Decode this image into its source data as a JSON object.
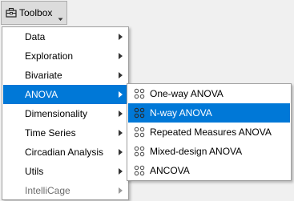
{
  "toolbar": {
    "toolbox_label": "Toolbox"
  },
  "main_menu": {
    "items": [
      {
        "label": "Data",
        "has_submenu": true,
        "highlighted": false,
        "disabled": false
      },
      {
        "label": "Exploration",
        "has_submenu": true,
        "highlighted": false,
        "disabled": false
      },
      {
        "label": "Bivariate",
        "has_submenu": true,
        "highlighted": false,
        "disabled": false
      },
      {
        "label": "ANOVA",
        "has_submenu": true,
        "highlighted": true,
        "disabled": false
      },
      {
        "label": "Dimensionality",
        "has_submenu": true,
        "highlighted": false,
        "disabled": false
      },
      {
        "label": "Time Series",
        "has_submenu": true,
        "highlighted": false,
        "disabled": false
      },
      {
        "label": "Circadian Analysis",
        "has_submenu": true,
        "highlighted": false,
        "disabled": false
      },
      {
        "label": "Utils",
        "has_submenu": true,
        "highlighted": false,
        "disabled": false
      },
      {
        "label": "IntelliCage",
        "has_submenu": true,
        "highlighted": false,
        "disabled": true
      }
    ]
  },
  "anova_submenu": {
    "items": [
      {
        "label": "One-way ANOVA",
        "icon": "widget-icon",
        "highlighted": false
      },
      {
        "label": "N-way ANOVA",
        "icon": "widget-icon",
        "highlighted": true
      },
      {
        "label": "Repeated Measures ANOVA",
        "icon": "widget-icon",
        "highlighted": false
      },
      {
        "label": "Mixed-design ANOVA",
        "icon": "widget-icon",
        "highlighted": false
      },
      {
        "label": "ANCOVA",
        "icon": "widget-icon",
        "highlighted": false
      }
    ]
  },
  "colors": {
    "highlight": "#0078d7",
    "highlight_text": "#ffffff",
    "disabled_text": "#6d6d6d",
    "background": "#f0f0f0"
  }
}
